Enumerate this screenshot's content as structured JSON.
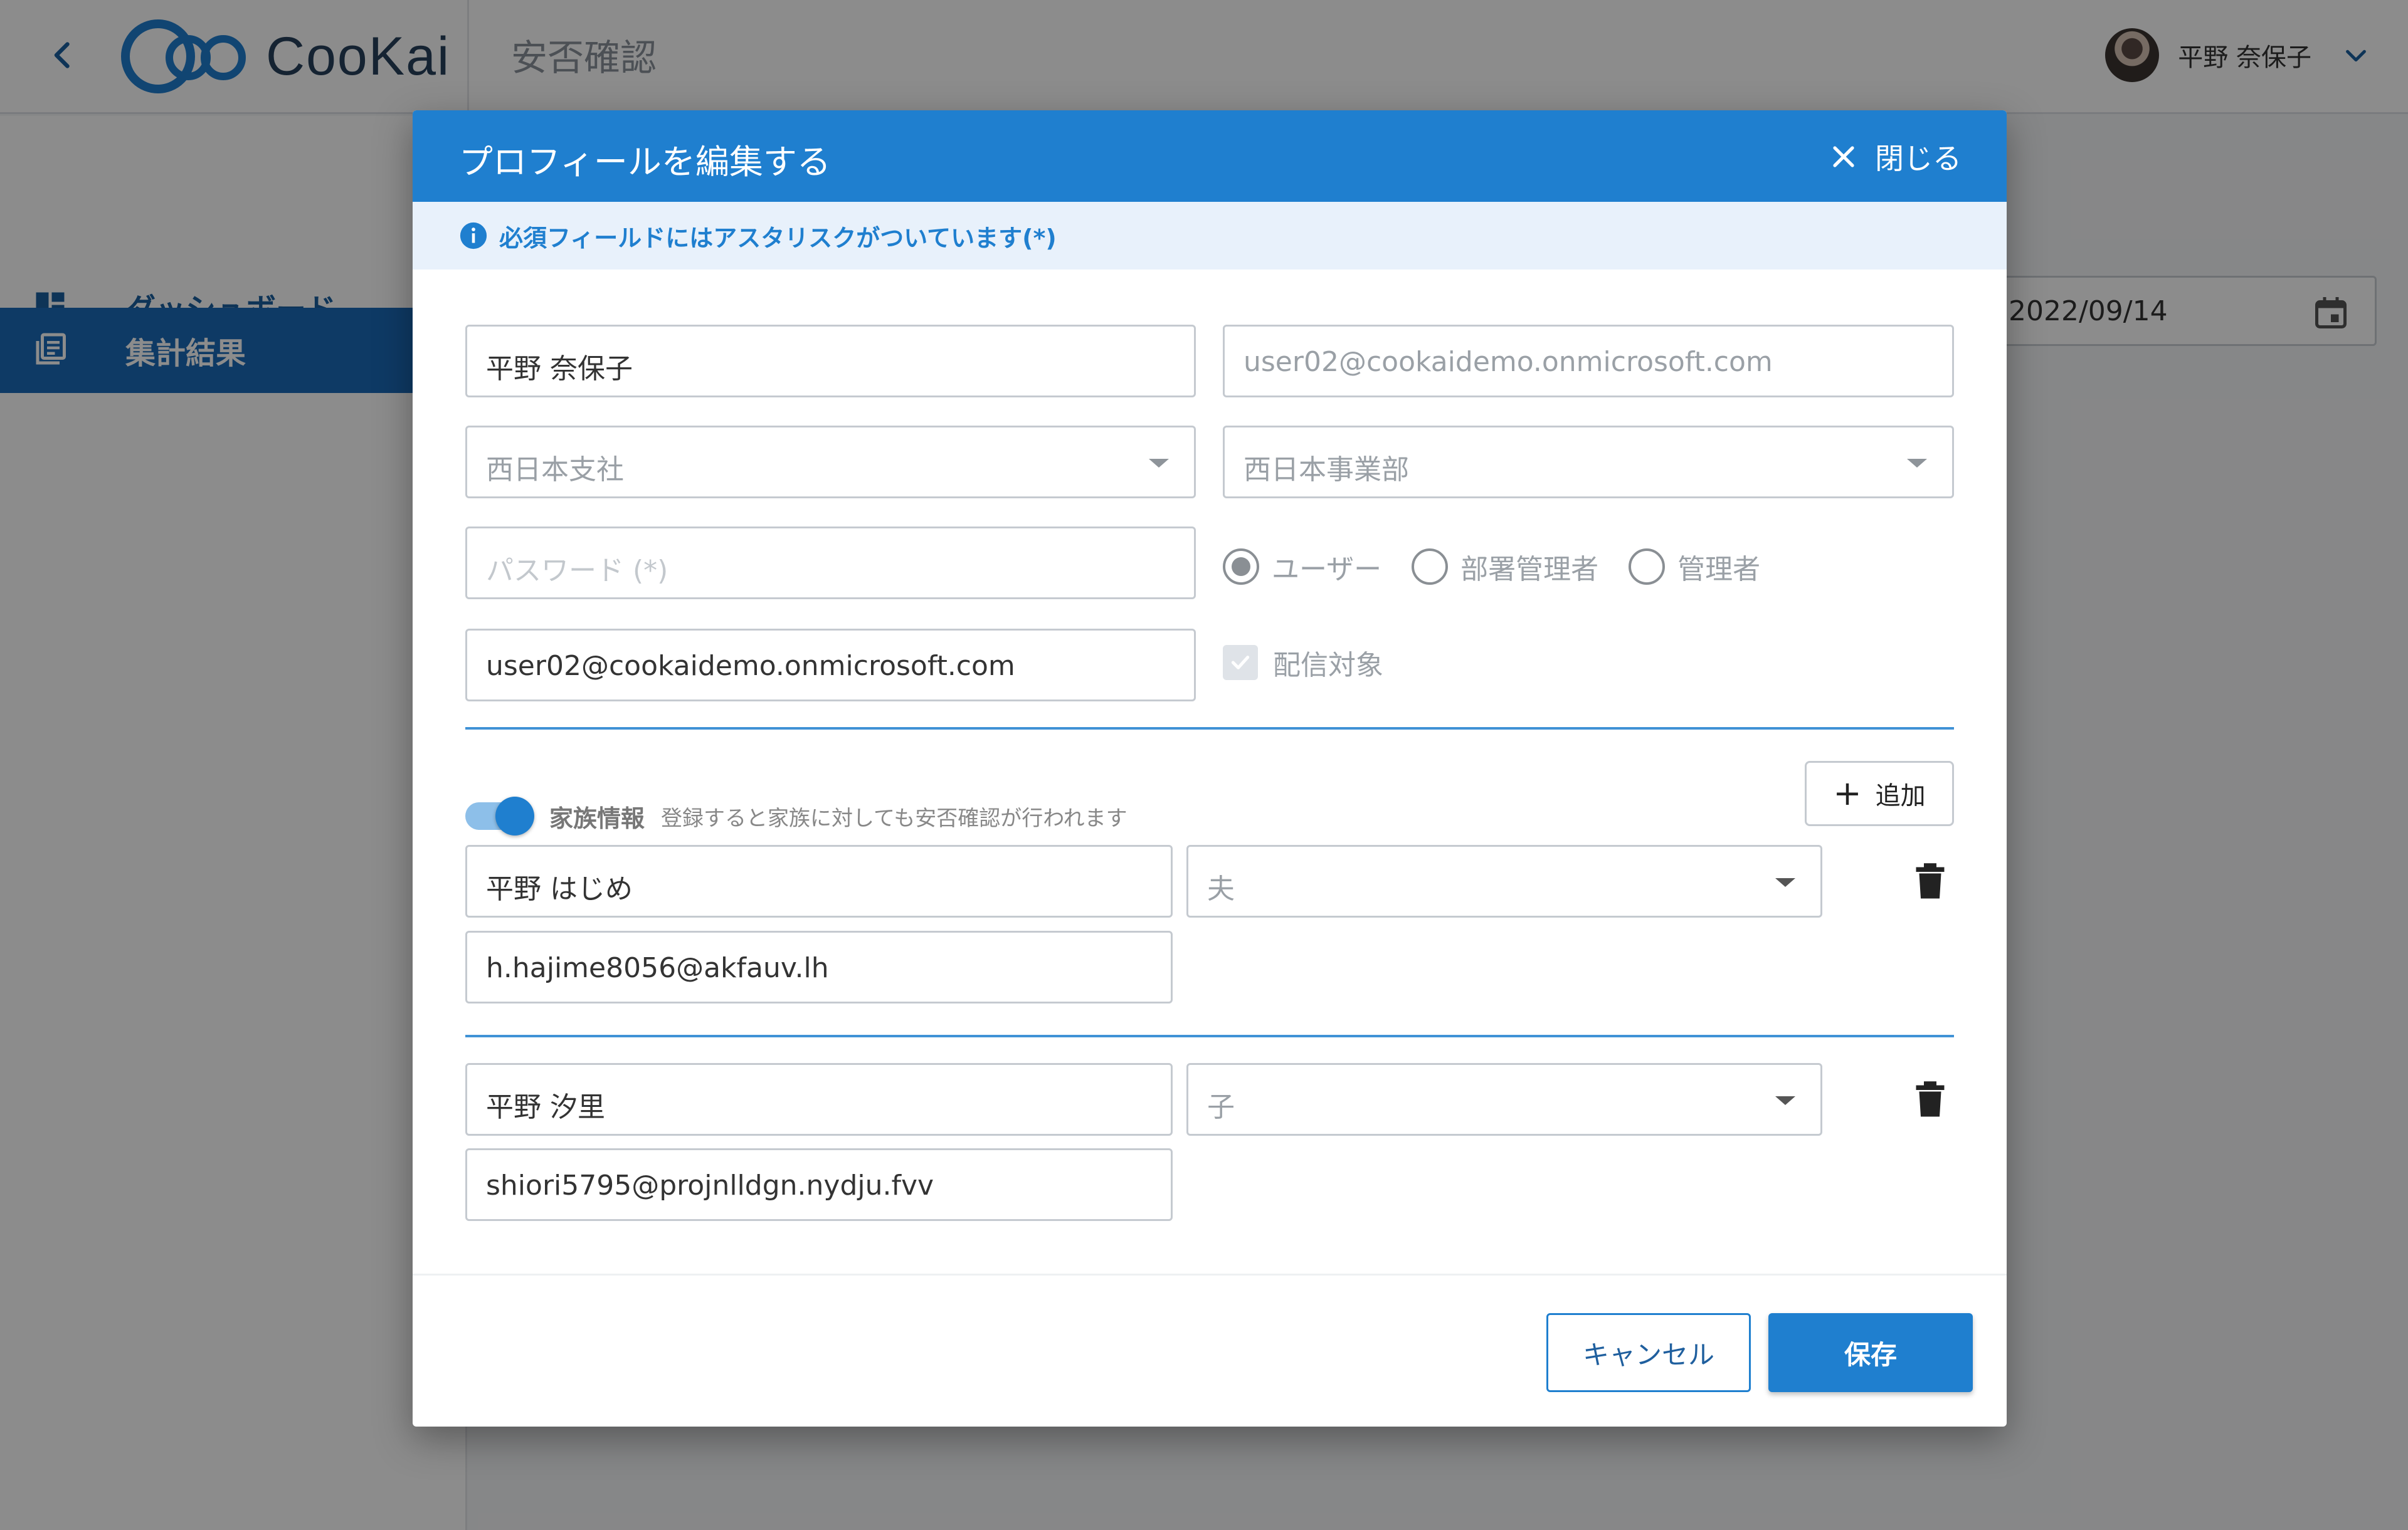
{
  "app": {
    "logo_text": "CooKai",
    "page_title": "安否確認",
    "user_name": "平野 奈保子"
  },
  "sidebar": {
    "items": [
      {
        "label": "ダッシュボード",
        "icon": "dashboard-icon",
        "active": false
      },
      {
        "label": "集計結果",
        "icon": "report-icon",
        "active": true
      }
    ]
  },
  "background": {
    "date_value": "2022/09/14"
  },
  "modal": {
    "title": "プロフィールを編集する",
    "close_label": "閉じる",
    "notice": "必須フィールドにはアスタリスクがついています(*)",
    "fields": {
      "name": "平野 奈保子",
      "email_readonly": "user02@cookaidemo.onmicrosoft.com",
      "branch": "西日本支社",
      "department": "西日本事業部",
      "password_placeholder": "パスワード (*)",
      "notify_email": "user02@cookaidemo.onmicrosoft.com"
    },
    "roles": [
      {
        "label": "ユーザー",
        "selected": true
      },
      {
        "label": "部署管理者",
        "selected": false
      },
      {
        "label": "管理者",
        "selected": false
      }
    ],
    "delivery_label": "配信対象",
    "family": {
      "enabled": true,
      "label": "家族情報",
      "hint": "登録すると家族に対しても安否確認が行われます",
      "add_label": "追加",
      "members": [
        {
          "name": "平野 はじめ",
          "relation": "夫",
          "email": "h.hajime8056@akfauv.lh"
        },
        {
          "name": "平野 汐里",
          "relation": "子",
          "email": "shiori5795@projnlldgn.nydju.fvv"
        }
      ]
    },
    "buttons": {
      "cancel": "キャンセル",
      "save": "保存"
    }
  },
  "colors": {
    "primary": "#1f7fcf",
    "sidebar_active": "#1a6ab8",
    "notice_bg": "#e8f1fb"
  }
}
